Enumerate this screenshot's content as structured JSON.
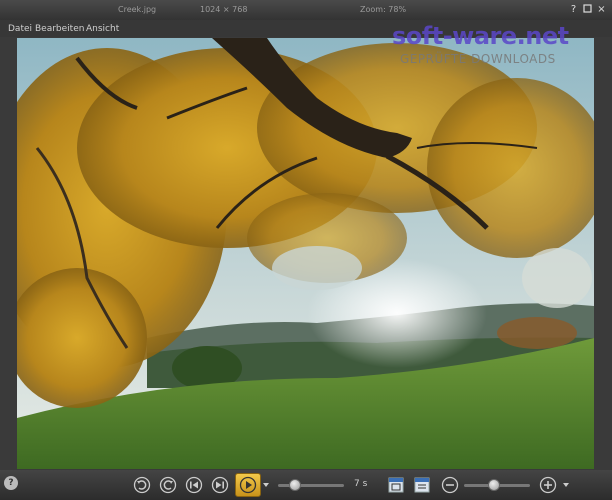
{
  "titlebar": {
    "filename": "Creek.jpg",
    "dimensions": "1024 × 768",
    "zoom": "Zoom: 78%",
    "help_label": "?",
    "close_label": "×"
  },
  "menu": {
    "items": [
      "Datei",
      "Bearbeiten",
      "Ansicht"
    ]
  },
  "watermark": {
    "main": "soft-ware.net",
    "sub": "GEPRÜFTE DOWNLOADS"
  },
  "toolbar": {
    "help_label": "?",
    "speed_label": "7 s",
    "slideshow_speed": 0.25,
    "zoom_level": 0.45
  },
  "colors": {
    "accent": "#d4a017",
    "background": "#3a3a3a",
    "toolbar": "#2f2f2f"
  }
}
